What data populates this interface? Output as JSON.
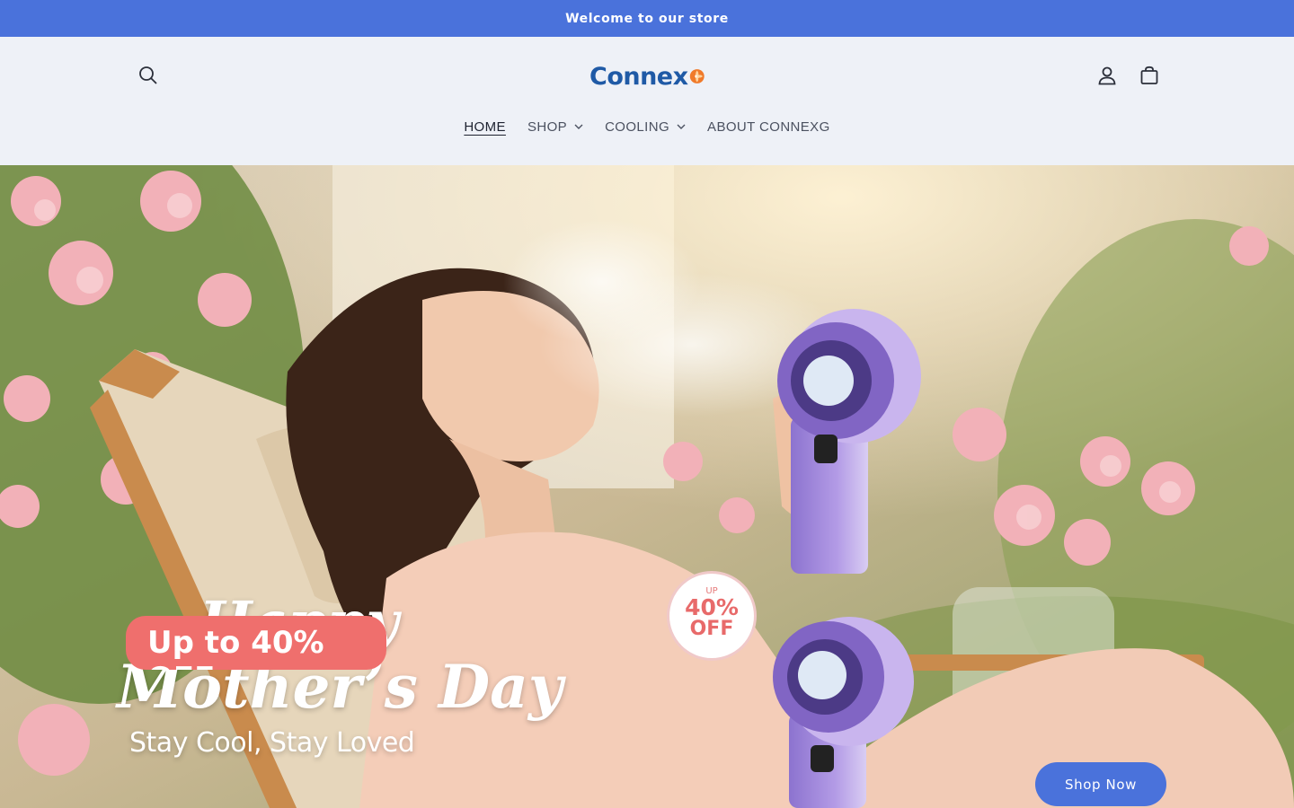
{
  "announcement": {
    "text": "Welcome to our store"
  },
  "header": {
    "logo_text": "Connex",
    "icons": {
      "search": "search-icon",
      "account": "user-icon",
      "cart": "cart-icon"
    }
  },
  "nav": {
    "items": [
      {
        "label": "HOME",
        "active": true,
        "has_dropdown": false
      },
      {
        "label": "SHOP",
        "active": false,
        "has_dropdown": true
      },
      {
        "label": "COOLING",
        "active": false,
        "has_dropdown": true
      },
      {
        "label": "ABOUT CONNEXG",
        "active": false,
        "has_dropdown": false
      }
    ]
  },
  "hero": {
    "headline_line1": "Happy",
    "headline_line2": "Mother’s Day",
    "subheadline": "Stay Cool, Stay Loved",
    "promo": "Up to 40% OFF",
    "badge": {
      "up": "UP",
      "percent": "40%",
      "off": "OFF"
    },
    "cta_label": "Shop Now"
  },
  "colors": {
    "brand_blue": "#4a72db",
    "background": "#eef1f7",
    "promo_pink": "#ef6f6d"
  }
}
